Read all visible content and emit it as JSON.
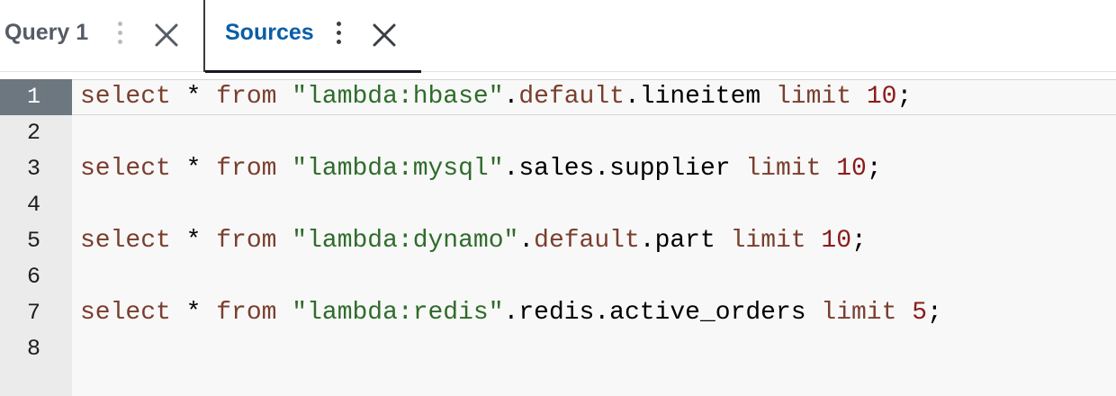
{
  "tabs": [
    {
      "label": "Query 1",
      "active": false
    },
    {
      "label": "Sources",
      "active": true
    }
  ],
  "editor": {
    "active_line": 1,
    "lines": [
      {
        "number": "1",
        "tokens": [
          {
            "t": "select",
            "c": "kw"
          },
          {
            "t": " * ",
            "c": "plain"
          },
          {
            "t": "from",
            "c": "kw"
          },
          {
            "t": " ",
            "c": "plain"
          },
          {
            "t": "\"lambda:hbase\"",
            "c": "str"
          },
          {
            "t": ".",
            "c": "plain"
          },
          {
            "t": "default",
            "c": "kw"
          },
          {
            "t": ".lineitem ",
            "c": "plain"
          },
          {
            "t": "limit",
            "c": "kw"
          },
          {
            "t": " ",
            "c": "plain"
          },
          {
            "t": "10",
            "c": "num"
          },
          {
            "t": ";",
            "c": "plain"
          }
        ]
      },
      {
        "number": "2",
        "tokens": []
      },
      {
        "number": "3",
        "tokens": [
          {
            "t": "select",
            "c": "kw"
          },
          {
            "t": " * ",
            "c": "plain"
          },
          {
            "t": "from",
            "c": "kw"
          },
          {
            "t": " ",
            "c": "plain"
          },
          {
            "t": "\"lambda:mysql\"",
            "c": "str"
          },
          {
            "t": ".sales.supplier ",
            "c": "plain"
          },
          {
            "t": "limit",
            "c": "kw"
          },
          {
            "t": " ",
            "c": "plain"
          },
          {
            "t": "10",
            "c": "num"
          },
          {
            "t": ";",
            "c": "plain"
          }
        ]
      },
      {
        "number": "4",
        "tokens": []
      },
      {
        "number": "5",
        "tokens": [
          {
            "t": "select",
            "c": "kw"
          },
          {
            "t": " * ",
            "c": "plain"
          },
          {
            "t": "from",
            "c": "kw"
          },
          {
            "t": " ",
            "c": "plain"
          },
          {
            "t": "\"lambda:dynamo\"",
            "c": "str"
          },
          {
            "t": ".",
            "c": "plain"
          },
          {
            "t": "default",
            "c": "kw"
          },
          {
            "t": ".part ",
            "c": "plain"
          },
          {
            "t": "limit",
            "c": "kw"
          },
          {
            "t": " ",
            "c": "plain"
          },
          {
            "t": "10",
            "c": "num"
          },
          {
            "t": ";",
            "c": "plain"
          }
        ]
      },
      {
        "number": "6",
        "tokens": []
      },
      {
        "number": "7",
        "tokens": [
          {
            "t": "select",
            "c": "kw"
          },
          {
            "t": " * ",
            "c": "plain"
          },
          {
            "t": "from",
            "c": "kw"
          },
          {
            "t": " ",
            "c": "plain"
          },
          {
            "t": "\"lambda:redis\"",
            "c": "str"
          },
          {
            "t": ".redis.active_orders ",
            "c": "plain"
          },
          {
            "t": "limit",
            "c": "kw"
          },
          {
            "t": " ",
            "c": "plain"
          },
          {
            "t": "5",
            "c": "num"
          },
          {
            "t": ";",
            "c": "plain"
          }
        ]
      },
      {
        "number": "8",
        "tokens": []
      }
    ]
  },
  "colors": {
    "active_tab_text": "#0a5da8",
    "keyword": "#7a3e2e",
    "string": "#2f6b2a",
    "number": "#8a1b1b"
  }
}
